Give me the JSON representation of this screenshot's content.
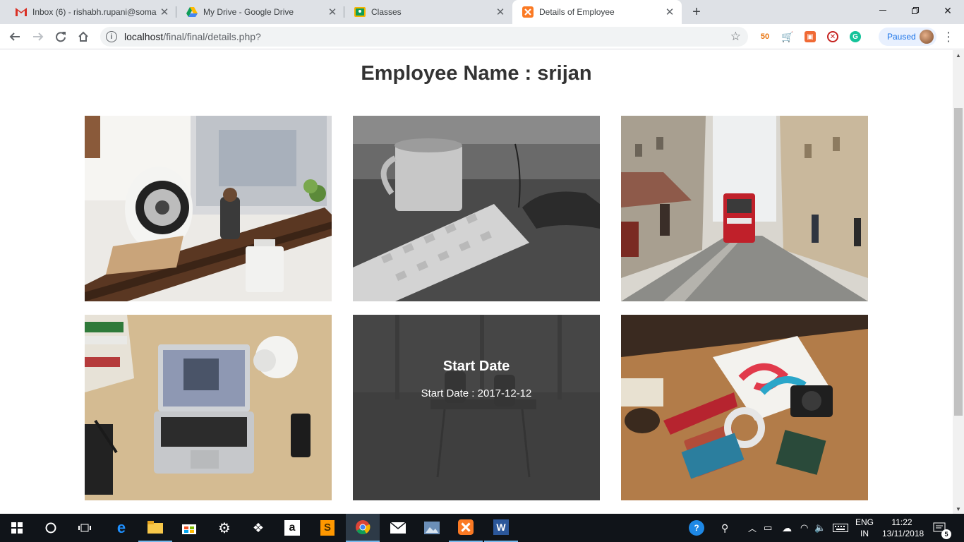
{
  "browser": {
    "tabs": [
      {
        "title": "Inbox (6) - rishabh.rupani@soma",
        "favicon": "gmail-icon"
      },
      {
        "title": "My Drive - Google Drive",
        "favicon": "drive-icon"
      },
      {
        "title": "Classes",
        "favicon": "classroom-icon"
      },
      {
        "title": "Details of Employee",
        "favicon": "xampp-icon",
        "active": true
      }
    ],
    "url_host": "localhost",
    "url_path": "/final/final/details.php?",
    "profile_status": "Paused",
    "extensions": [
      "50 badge",
      "cart",
      "lock",
      "blocker",
      "grammarly"
    ]
  },
  "page": {
    "heading": "Employee Name : srijan",
    "tiles": [
      {
        "image": "desk-speaker-photo"
      },
      {
        "image": "keyboard-mug-photo"
      },
      {
        "image": "tram-street-photo"
      },
      {
        "image": "laptop-desk-photo"
      },
      {
        "image": "chairs-room-photo",
        "overlay_title": "Start Date",
        "overlay_text": "Start Date : 2017-12-12"
      },
      {
        "image": "workspace-flatlay-photo"
      }
    ]
  },
  "taskbar": {
    "apps": [
      "windows-start-icon",
      "cortana-icon",
      "task-view-icon",
      "edge-icon",
      "file-explorer-icon",
      "store-icon",
      "settings-icon",
      "dropbox-icon",
      "amazon-icon",
      "sublime-icon",
      "chrome-icon",
      "mail-icon",
      "photos-icon",
      "xampp-icon",
      "word-icon"
    ],
    "lang_top": "ENG",
    "lang_bottom": "IN",
    "time": "11:22",
    "date": "13/11/2018",
    "notifications": "5"
  },
  "colors": {
    "tabstrip": "#dee1e6",
    "heading": "#333333",
    "overlay": "#373737",
    "taskbar": "#101419",
    "accent": "#1a73e8"
  }
}
